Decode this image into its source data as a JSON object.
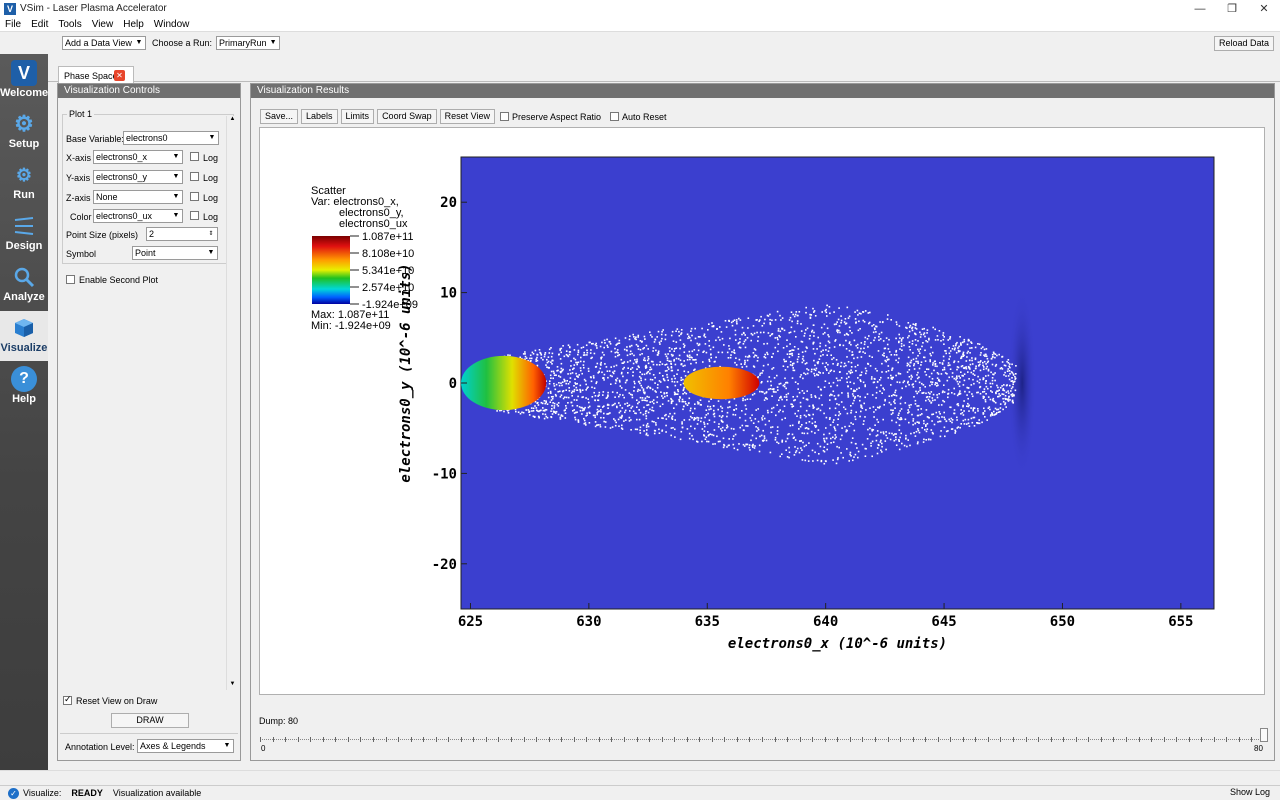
{
  "window": {
    "title": "VSim - Laser Plasma Accelerator",
    "logo": "V"
  },
  "menu": [
    "File",
    "Edit",
    "Tools",
    "View",
    "Help",
    "Window"
  ],
  "toolbar": {
    "add_view": "Add a Data View",
    "choose_run_label": "Choose a Run:",
    "run_value": "PrimaryRun",
    "reload": "Reload Data"
  },
  "nav": [
    {
      "label": "Welcome",
      "icon": "vsim-logo-icon"
    },
    {
      "label": "Setup",
      "icon": "gear-icon"
    },
    {
      "label": "Run",
      "icon": "gears-icon"
    },
    {
      "label": "Design",
      "icon": "design-lines-icon"
    },
    {
      "label": "Analyze",
      "icon": "magnifier-icon"
    },
    {
      "label": "Visualize",
      "icon": "cube-icon"
    },
    {
      "label": "Help",
      "icon": "question-icon"
    }
  ],
  "tab": {
    "label": "Phase Space"
  },
  "controls": {
    "header": "Visualization Controls",
    "group_title": "Plot 1",
    "base_variable_label": "Base Variable:",
    "base_variable": "electrons0",
    "x_label": "X-axis",
    "x_value": "electrons0_x",
    "y_label": "Y-axis",
    "y_value": "electrons0_y",
    "z_label": "Z-axis",
    "z_value": "None",
    "color_label": "Color",
    "color_value": "electrons0_ux",
    "log_label": "Log",
    "point_size_label": "Point Size (pixels)",
    "point_size": "2",
    "symbol_label": "Symbol",
    "symbol_value": "Point",
    "second_plot": "Enable Second Plot",
    "reset_view": "Reset View on Draw",
    "draw": "DRAW",
    "annotation_label": "Annotation Level:",
    "annotation_value": "Axes & Legends"
  },
  "results": {
    "header": "Visualization Results",
    "buttons": [
      "Save...",
      "Labels",
      "Limits",
      "Coord Swap",
      "Reset View"
    ],
    "preserve_aspect": "Preserve Aspect Ratio",
    "auto_reset": "Auto Reset"
  },
  "legend": {
    "title": "Scatter",
    "var_line1": "Var: electrons0_x,",
    "var_line2": "electrons0_y,",
    "var_line3": "electrons0_ux",
    "ticks": [
      "1.087e+11",
      "8.108e+10",
      "5.341e+10",
      "2.574e+10",
      "-1.924e+09"
    ],
    "max": "Max:  1.087e+11",
    "min": "Min: -1.924e+09"
  },
  "chart_data": {
    "type": "scatter",
    "title": "",
    "xlabel": "electrons0_x (10^-6 units)",
    "ylabel": "electrons0_y (10^-6 units)",
    "xlim": [
      624.6,
      656.4
    ],
    "ylim": [
      -25,
      25
    ],
    "x_ticks": [
      625,
      630,
      635,
      640,
      645,
      650,
      655
    ],
    "y_ticks": [
      20,
      10,
      0,
      -10,
      -20
    ],
    "background_color": "#3b3fcf",
    "regions": [
      {
        "name": "trailing bunch",
        "x_range": [
          624.6,
          628.2
        ],
        "y_range": [
          -3,
          3
        ],
        "color_range": "cyan to red"
      },
      {
        "name": "trapped bunch",
        "x_range": [
          634,
          637.2
        ],
        "y_range": [
          -1.8,
          1.8
        ],
        "color_range": "orange to red"
      },
      {
        "name": "plasma cone",
        "x_range": [
          626,
          648
        ],
        "y_range": [
          -9,
          9
        ],
        "color": "#ffffff"
      }
    ]
  },
  "slider": {
    "label": "Dump: 80",
    "min": "0",
    "max": "80",
    "value": 80
  },
  "status": {
    "prefix": "Visualize:",
    "state": "READY",
    "message": "Visualization available",
    "show_log": "Show Log"
  }
}
